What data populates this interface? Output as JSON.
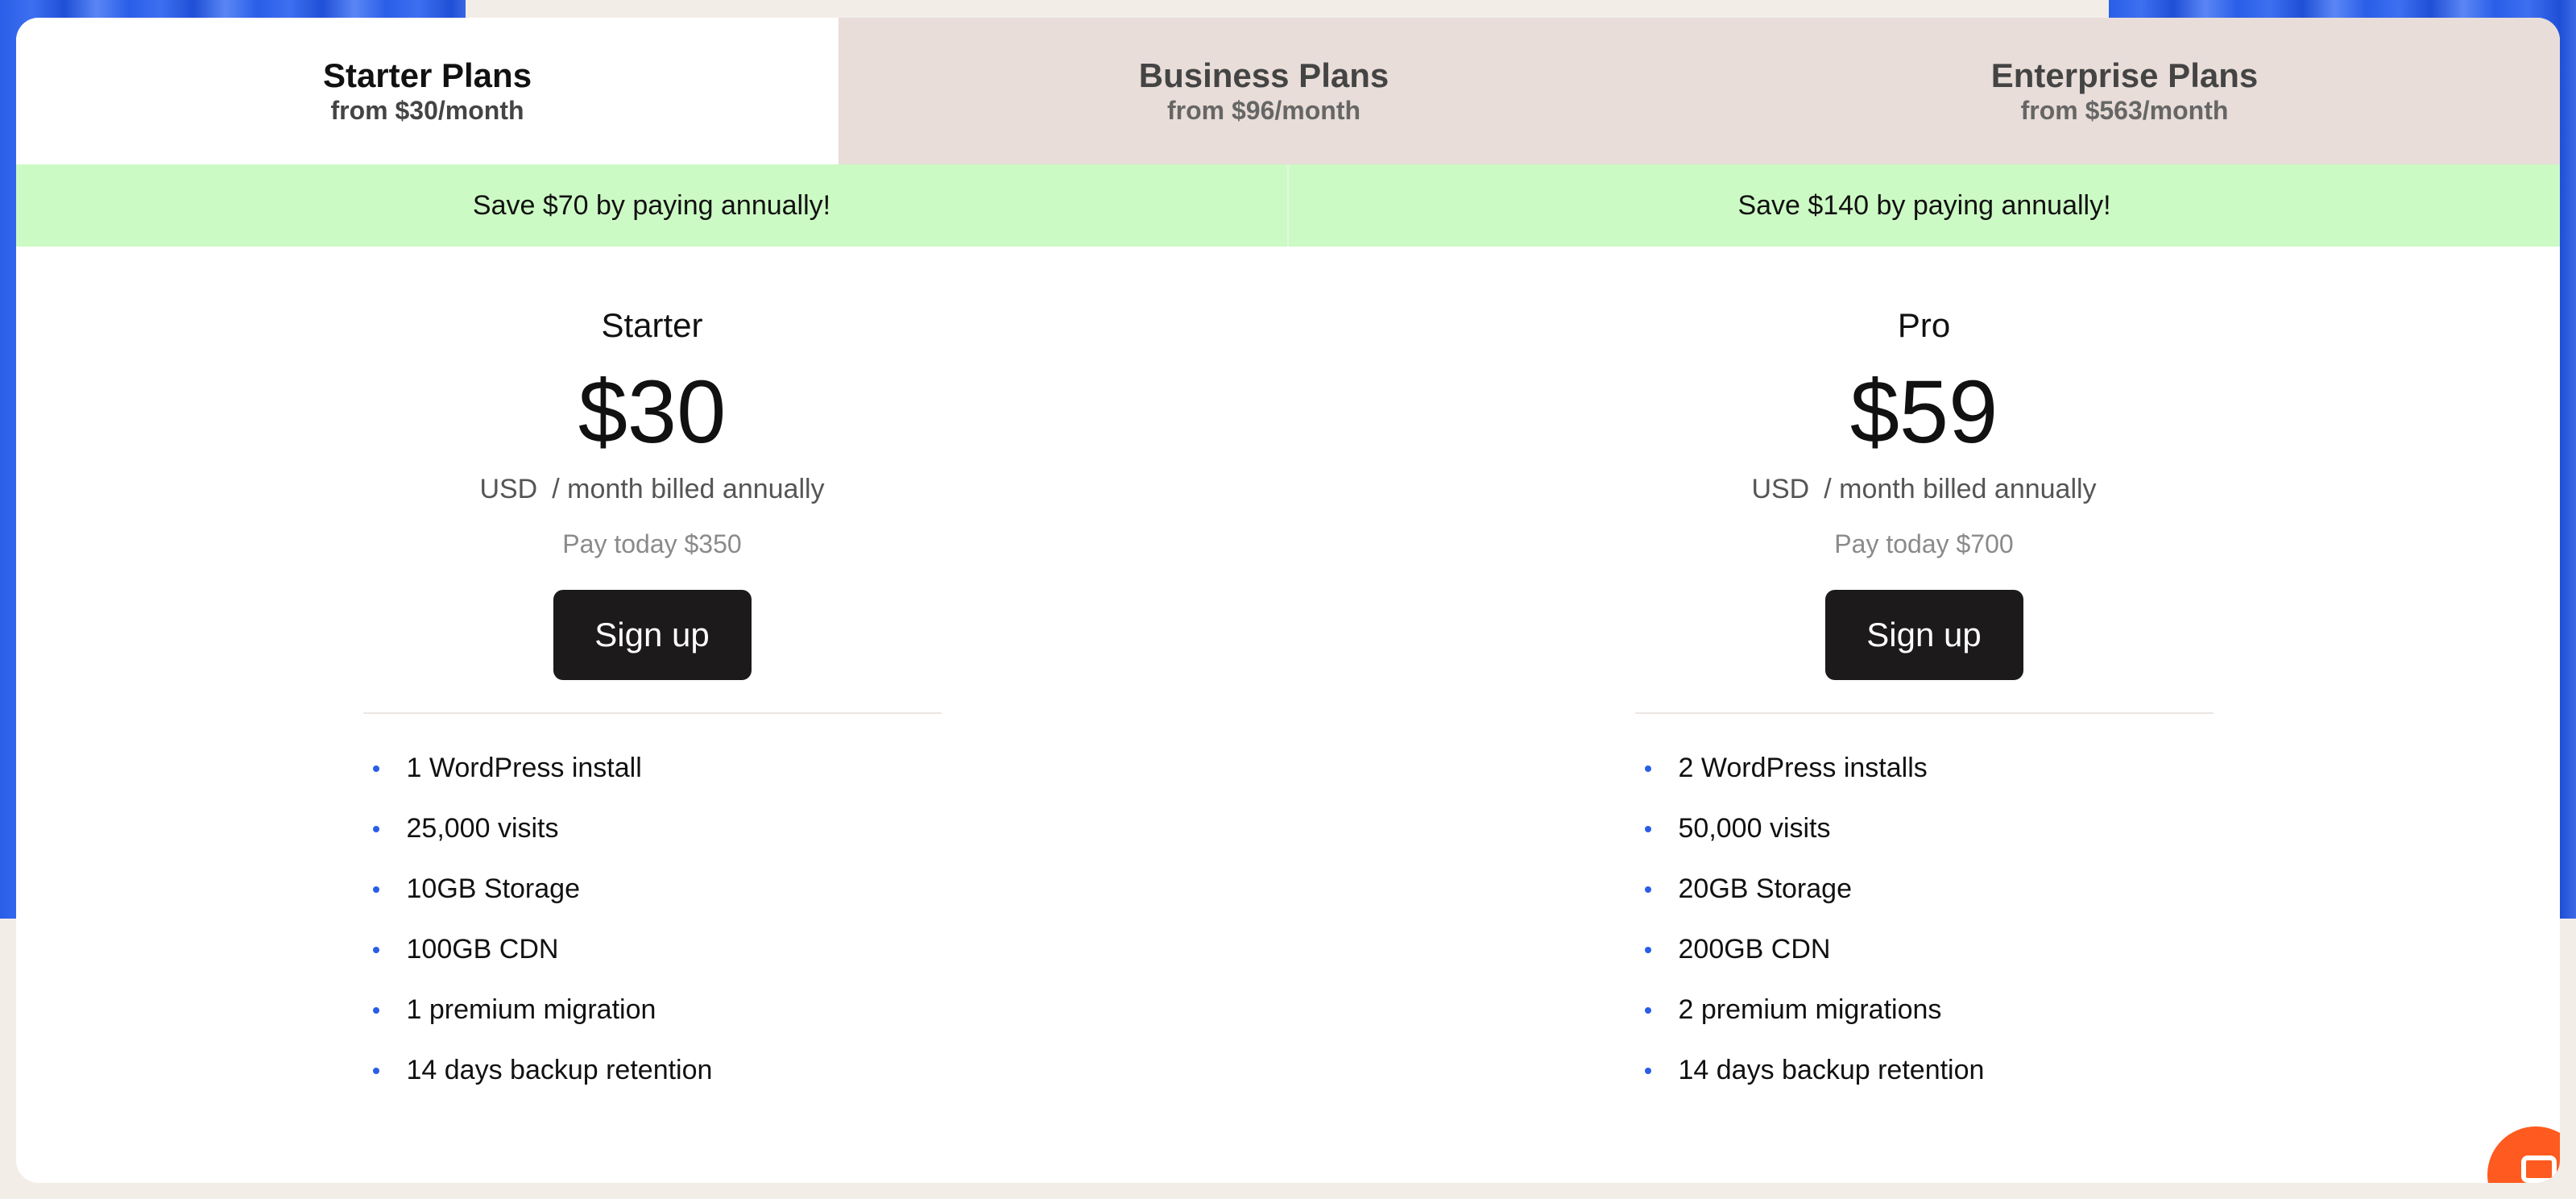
{
  "tabs": [
    {
      "title": "Starter Plans",
      "subtitle": "from $30/month",
      "active": true
    },
    {
      "title": "Business Plans",
      "subtitle": "from $96/month",
      "active": false
    },
    {
      "title": "Enterprise Plans",
      "subtitle": "from $563/month",
      "active": false
    }
  ],
  "savings": [
    "Save $70 by paying annually!",
    "Save $140 by paying annually!"
  ],
  "plans": [
    {
      "name": "Starter",
      "price": "$30",
      "currency": "USD",
      "period": "/ month billed annually",
      "pay_today": "Pay today $350",
      "cta": "Sign up",
      "features": [
        "1 WordPress install",
        "25,000 visits",
        "10GB Storage",
        "100GB CDN",
        "1 premium migration",
        "14 days backup retention"
      ]
    },
    {
      "name": "Pro",
      "price": "$59",
      "currency": "USD",
      "period": "/ month billed annually",
      "pay_today": "Pay today $700",
      "cta": "Sign up",
      "features": [
        "2 WordPress installs",
        "50,000 visits",
        "20GB Storage",
        "200GB CDN",
        "2 premium migrations",
        "14 days backup retention"
      ]
    }
  ],
  "colors": {
    "accent_bullet": "#2a5ee8",
    "savings_bg": "#ccfac4",
    "button_bg": "#1c1a1b",
    "chat_bubble": "#ff5a1f"
  },
  "icons": {
    "chat": "chat-icon"
  }
}
